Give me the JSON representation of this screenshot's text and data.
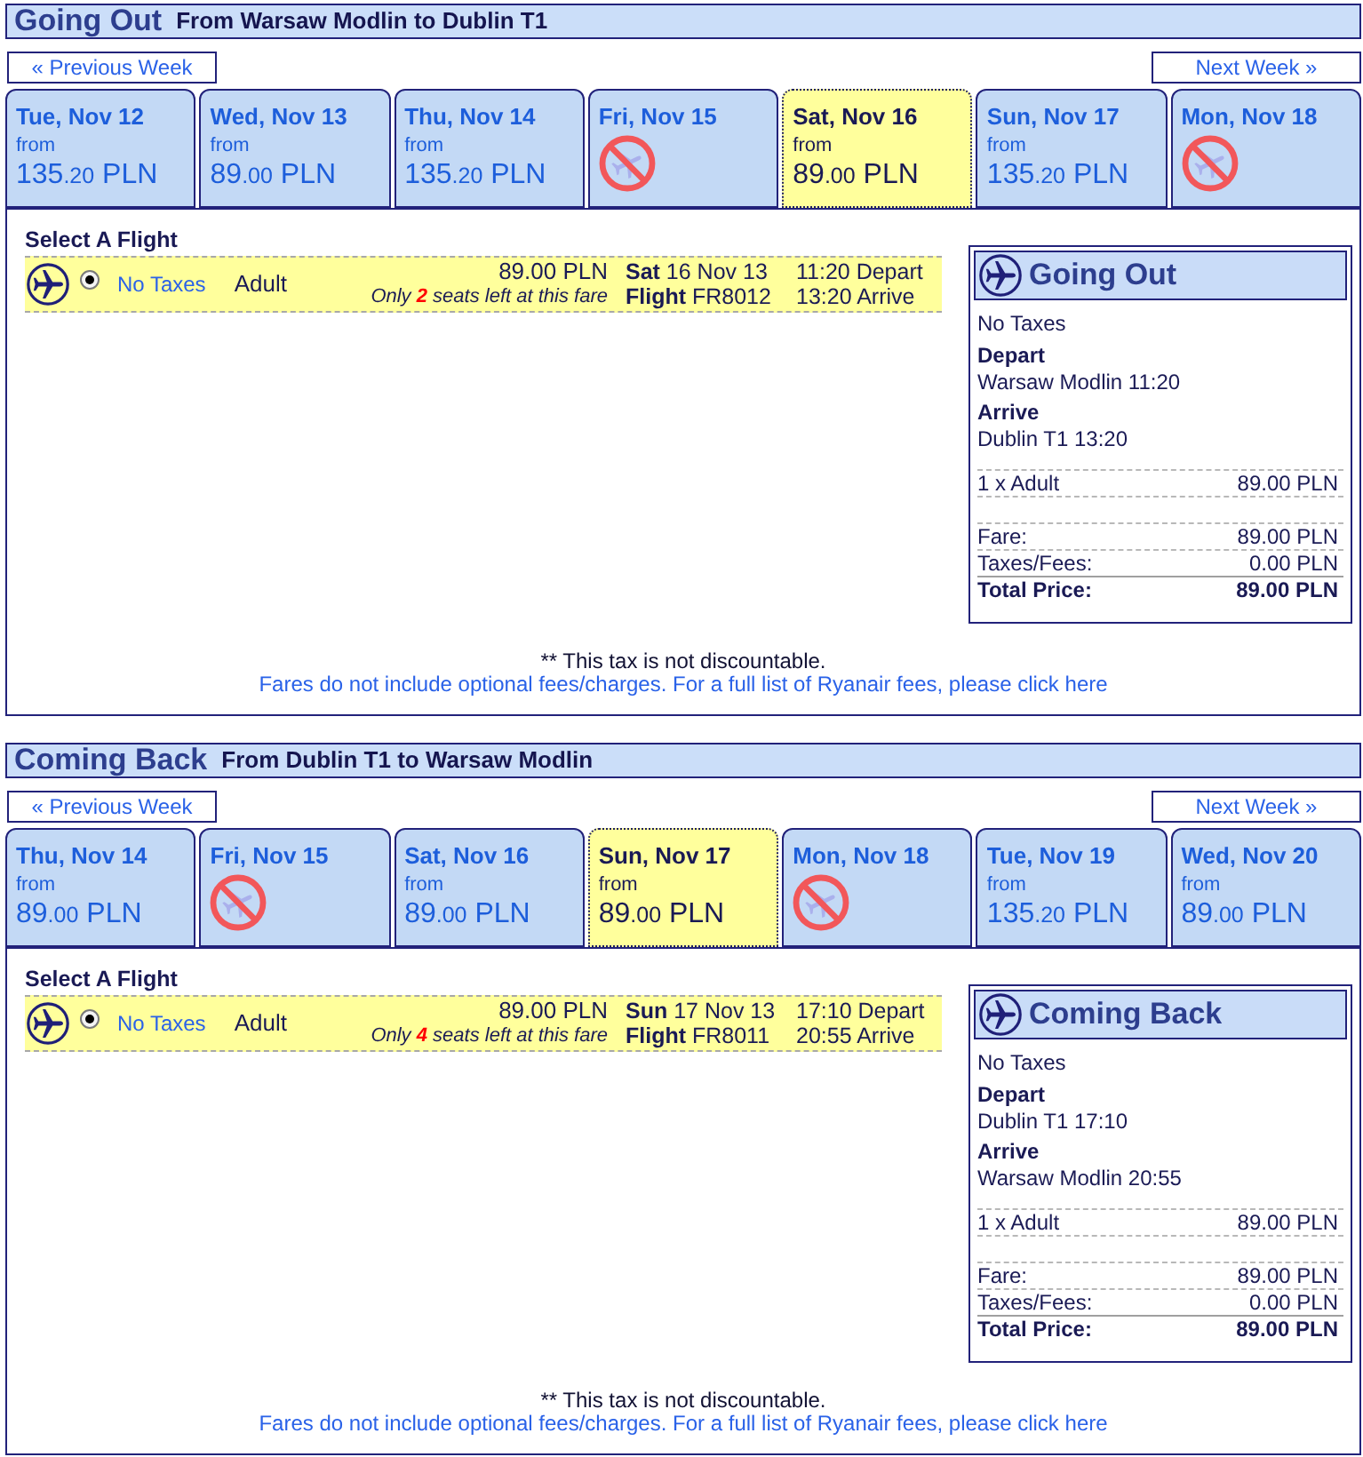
{
  "sections": [
    {
      "title": "Going Out",
      "route": "From Warsaw Modlin to Dublin T1",
      "prev_week": "« Previous Week",
      "next_week": "Next Week »",
      "days": [
        {
          "date": "Tue, Nov 12",
          "selected": false,
          "available": true,
          "from": "from",
          "price": {
            "whole": "135",
            "fraction": ".20",
            "currency": "PLN"
          }
        },
        {
          "date": "Wed, Nov 13",
          "selected": false,
          "available": true,
          "from": "from",
          "price": {
            "whole": "89",
            "fraction": ".00",
            "currency": "PLN"
          }
        },
        {
          "date": "Thu, Nov 14",
          "selected": false,
          "available": true,
          "from": "from",
          "price": {
            "whole": "135",
            "fraction": ".20",
            "currency": "PLN"
          }
        },
        {
          "date": "Fri, Nov 15",
          "selected": false,
          "available": false
        },
        {
          "date": "Sat, Nov 16",
          "selected": true,
          "available": true,
          "from": "from",
          "price": {
            "whole": "89",
            "fraction": ".00",
            "currency": "PLN"
          }
        },
        {
          "date": "Sun, Nov 17",
          "selected": false,
          "available": true,
          "from": "from",
          "price": {
            "whole": "135",
            "fraction": ".20",
            "currency": "PLN"
          }
        },
        {
          "date": "Mon, Nov 18",
          "selected": false,
          "available": false
        }
      ],
      "select_label": "Select A Flight",
      "flights": [
        {
          "selected": true,
          "fare_type": "No Taxes",
          "passenger": "Adult",
          "price": "89.00 PLN",
          "seats_note": "Only **2** seats left at this fare",
          "date": "**Sat** 16 Nov 13",
          "flight": "**Flight** FR8012",
          "depart": "11:20 Depart",
          "arrive": "13:20 Arrive"
        }
      ],
      "summary": {
        "title": "Going Out",
        "fare_type": "No Taxes",
        "depart_label": "Depart",
        "depart": "Warsaw Modlin 11:20",
        "arrive_label": "Arrive",
        "arrive": "Dublin T1 13:20",
        "lines": [
          {
            "label": "1 x Adult",
            "value": "89.00 PLN"
          }
        ],
        "totals": [
          {
            "kind": "subtotal",
            "label": "Fare:",
            "value": "89.00 PLN"
          },
          {
            "kind": "subtotal",
            "label": "Taxes/Fees:",
            "value": "0.00 PLN"
          },
          {
            "kind": "total",
            "label": "Total Price:",
            "value": "89.00 PLN"
          }
        ]
      },
      "notes": [
        {
          "kind": "plain",
          "text": "** This tax is not discountable."
        },
        {
          "kind": "link",
          "text": "Fares do not include optional fees/charges. For a full list of Ryanair fees, please click here"
        }
      ]
    },
    {
      "title": "Coming Back",
      "route": "From Dublin T1 to Warsaw Modlin",
      "prev_week": "« Previous Week",
      "next_week": "Next Week »",
      "days": [
        {
          "date": "Thu, Nov 14",
          "selected": false,
          "available": true,
          "from": "from",
          "price": {
            "whole": "89",
            "fraction": ".00",
            "currency": "PLN"
          }
        },
        {
          "date": "Fri, Nov 15",
          "selected": false,
          "available": false
        },
        {
          "date": "Sat, Nov 16",
          "selected": false,
          "available": true,
          "from": "from",
          "price": {
            "whole": "89",
            "fraction": ".00",
            "currency": "PLN"
          }
        },
        {
          "date": "Sun, Nov 17",
          "selected": true,
          "available": true,
          "from": "from",
          "price": {
            "whole": "89",
            "fraction": ".00",
            "currency": "PLN"
          }
        },
        {
          "date": "Mon, Nov 18",
          "selected": false,
          "available": false
        },
        {
          "date": "Tue, Nov 19",
          "selected": false,
          "available": true,
          "from": "from",
          "price": {
            "whole": "135",
            "fraction": ".20",
            "currency": "PLN"
          }
        },
        {
          "date": "Wed, Nov 20",
          "selected": false,
          "available": true,
          "from": "from",
          "price": {
            "whole": "89",
            "fraction": ".00",
            "currency": "PLN"
          }
        }
      ],
      "select_label": "Select A Flight",
      "flights": [
        {
          "selected": true,
          "fare_type": "No Taxes",
          "passenger": "Adult",
          "price": "89.00 PLN",
          "seats_note": "Only **4** seats left at this fare",
          "date": "**Sun** 17 Nov 13",
          "flight": "**Flight** FR8011",
          "depart": "17:10 Depart",
          "arrive": "20:55 Arrive"
        }
      ],
      "summary": {
        "title": "Coming Back",
        "fare_type": "No Taxes",
        "depart_label": "Depart",
        "depart": "Dublin T1 17:10",
        "arrive_label": "Arrive",
        "arrive": "Warsaw Modlin 20:55",
        "lines": [
          {
            "label": "1 x Adult",
            "value": "89.00 PLN"
          }
        ],
        "totals": [
          {
            "kind": "subtotal",
            "label": "Fare:",
            "value": "89.00 PLN"
          },
          {
            "kind": "subtotal",
            "label": "Taxes/Fees:",
            "value": "0.00 PLN"
          },
          {
            "kind": "total",
            "label": "Total Price:",
            "value": "89.00 PLN"
          }
        ]
      },
      "notes": [
        {
          "kind": "plain",
          "text": "** This tax is not discountable."
        },
        {
          "kind": "link",
          "text": "Fares do not include optional fees/charges. For a full list of Ryanair fees, please click here"
        }
      ]
    }
  ]
}
